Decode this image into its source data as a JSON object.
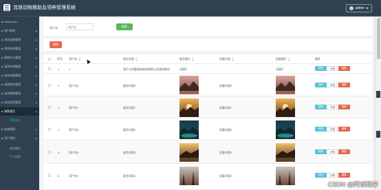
{
  "app": {
    "title": "流浪动物救助及领养管理系统",
    "user": "admin"
  },
  "sidebar": {
    "items": [
      {
        "label": "Dashboard"
      },
      {
        "label": "用户管理"
      },
      {
        "label": "流浪动物管理"
      },
      {
        "label": "领养动物管理"
      },
      {
        "label": "救助中心管理"
      },
      {
        "label": "领养申请管理"
      },
      {
        "label": "流浪动物管理"
      },
      {
        "label": "动物审核管理"
      },
      {
        "label": "流浪救助管理"
      },
      {
        "label": "活动信息管理"
      },
      {
        "label": "领养留言"
      },
      {
        "label": "系统管理"
      },
      {
        "label": "用户资料"
      }
    ],
    "sub_active": "领养留言",
    "sub_profile": [
      "修改密码",
      "个人信息"
    ]
  },
  "search": {
    "label": "用户名",
    "placeholder": "用户名",
    "button": "搜索"
  },
  "toolbar": {
    "batch_delete": "删除"
  },
  "table": {
    "headers": [
      "序号",
      "用户名",
      "留言内容",
      "留言图片",
      "回复内容",
      "回复图片",
      "操作"
    ],
    "ops": {
      "edit": "修改",
      "view": "详情",
      "delete": "删除"
    },
    "rows": [
      {
        "index": "1",
        "user": "1",
        "content": "我什么问题请来查收我的以及我的情况",
        "img_text": "无图片",
        "reply": "",
        "reply_img_text": "无图片"
      },
      {
        "index": "2",
        "user": "用户名8",
        "content": "留言内容8",
        "img_text": "",
        "reply": "回复内容8",
        "reply_img_text": ""
      },
      {
        "index": "3",
        "user": "用户名7",
        "content": "留言内容7",
        "img_text": "",
        "reply": "回复内容7",
        "reply_img_text": ""
      },
      {
        "index": "4",
        "user": "用户名6",
        "content": "留言内容6",
        "img_text": "",
        "reply": "回复内容6",
        "reply_img_text": ""
      },
      {
        "index": "5",
        "user": "用户名5",
        "content": "留言内容5",
        "img_text": "",
        "reply": "回复内容5",
        "reply_img_text": ""
      },
      {
        "index": "6",
        "user": "用户名4",
        "content": "留言内容4",
        "img_text": "",
        "reply": "回复内容4",
        "reply_img_text": ""
      }
    ]
  },
  "watermark": "CSDN @阿诚程序",
  "colors": {
    "sidebar": "#2f4050",
    "search_button": "#5cb85c",
    "delete_button": "#e8654f",
    "edit_button": "#5bc0de"
  }
}
